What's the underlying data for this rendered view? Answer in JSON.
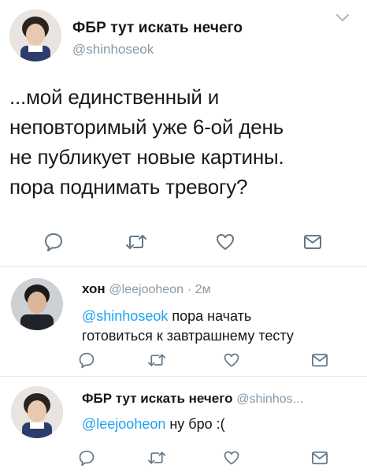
{
  "main_tweet": {
    "display_name": "ФБР тут искать нечего",
    "handle": "@shinhoseok",
    "text_lines": [
      "...мой единственный и",
      "неповторимый уже 6-ой день",
      "не публикует новые картины.",
      "пора поднимать тревогу?"
    ]
  },
  "replies": [
    {
      "display_name": "хон",
      "handle": "@leejooheon",
      "separator": "·",
      "time": "2м",
      "mention": "@shinhoseok",
      "text_first": " пора начать",
      "text_second": "готовиться к завтрашнему тесту"
    },
    {
      "display_name": "ФБР тут искать нечего",
      "handle": "@shinhos...",
      "mention": "@leejooheon",
      "text_first": " ну бро :("
    }
  ],
  "icons": {
    "reply": "reply-icon",
    "retweet": "retweet-icon",
    "like": "heart-icon",
    "dm": "envelope-icon",
    "menu": "chevron-down-icon"
  },
  "colors": {
    "text": "#14171a",
    "secondary": "#8899a6",
    "link": "#1da1f2",
    "icon": "#657786",
    "divider": "#e1e8ed"
  }
}
